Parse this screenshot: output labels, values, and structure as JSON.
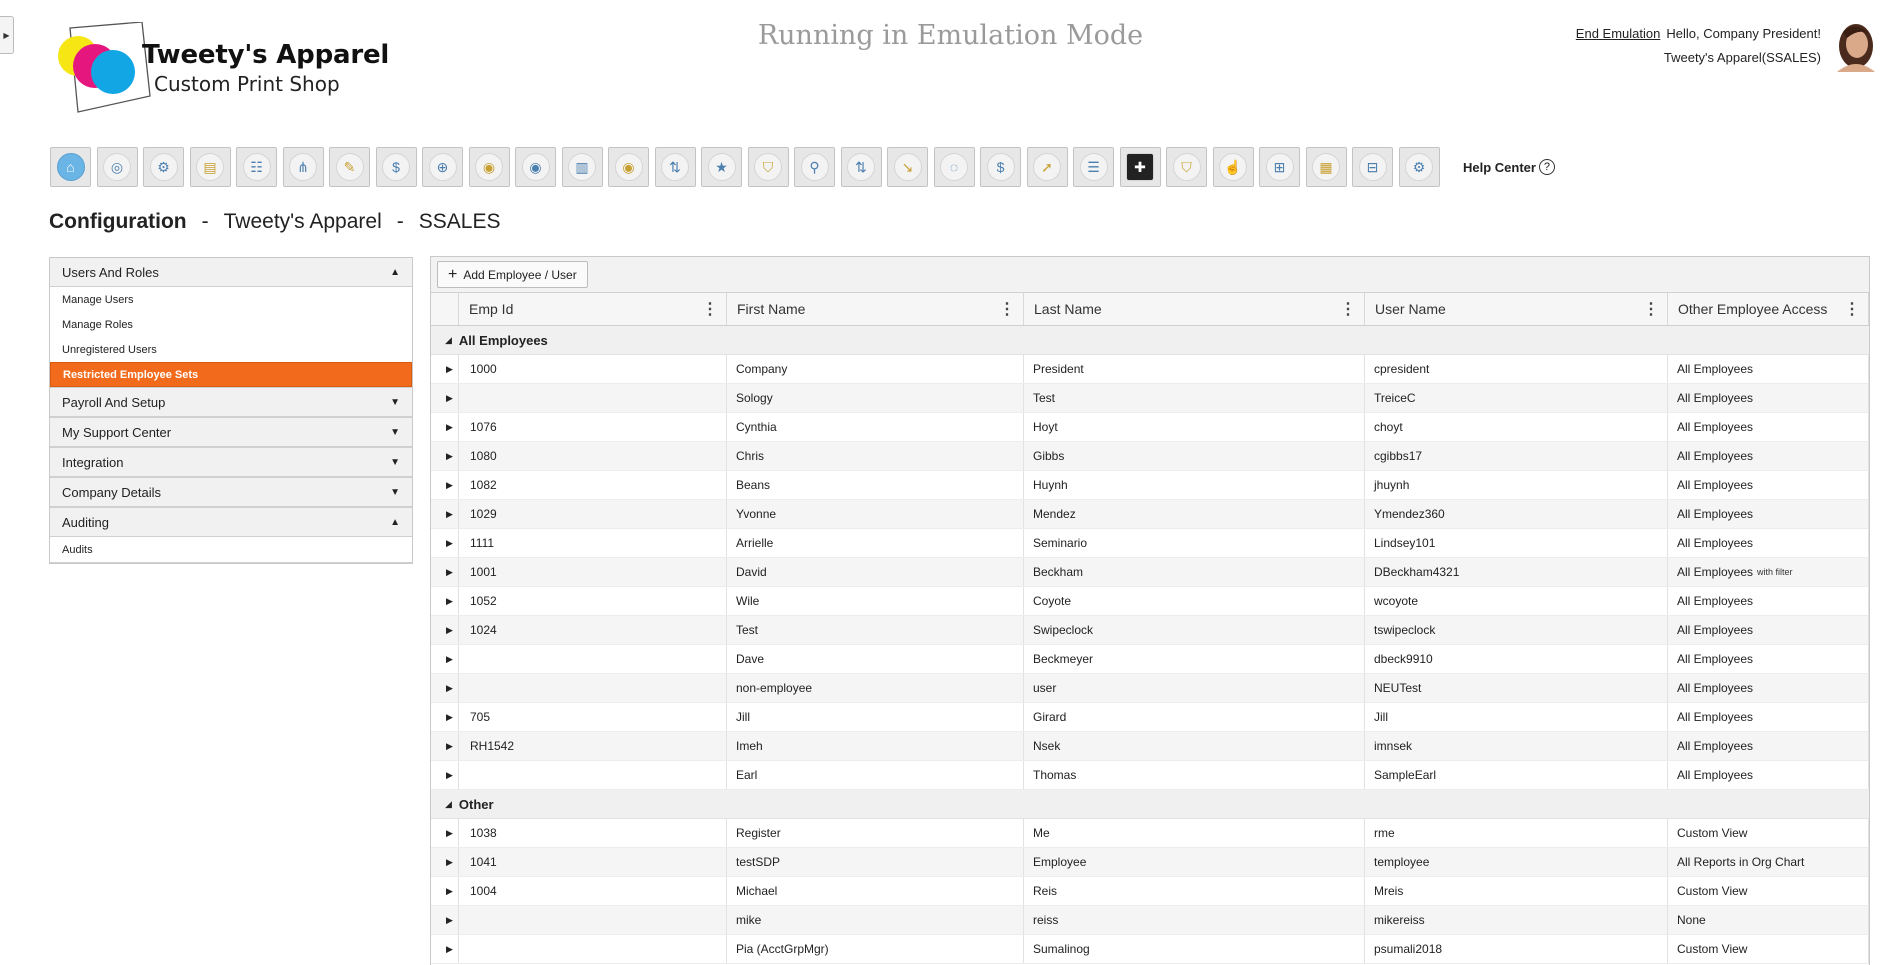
{
  "app": {
    "logo_title": "Tweety's Apparel",
    "logo_subtitle": "Custom Print Shop",
    "emulation_banner": "Running in Emulation Mode",
    "end_emulation": "End Emulation",
    "greeting": "Hello, Company President!",
    "company_context": "Tweety's Apparel(SSALES)"
  },
  "toolbar": {
    "icons": [
      "home-icon",
      "org-icon",
      "people-settings-icon",
      "job-icon",
      "group-icon",
      "hierarchy-icon",
      "form-edit-icon",
      "payroll-bag-icon",
      "search-add-icon",
      "target-icon",
      "target-icon",
      "chart-people-icon",
      "target-icon",
      "swap-icon",
      "person-star-icon",
      "shield-person-icon",
      "people-pin-icon",
      "swap-icon",
      "chart-down-icon",
      "fingerprint-icon",
      "money-bag-icon",
      "person-arrow-icon",
      "stack-people-icon",
      "clipboard-add-icon",
      "shield-person-icon",
      "hand-touch-icon",
      "gift-icon",
      "document-icon",
      "network-icon",
      "settings-search-icon"
    ],
    "help_center": "Help Center"
  },
  "heading": {
    "section": "Configuration",
    "company": "Tweety's Apparel",
    "code": "SSALES"
  },
  "sidebar": {
    "groups": [
      {
        "label": "Users And Roles",
        "expanded": true,
        "items": [
          {
            "label": "Manage Users"
          },
          {
            "label": "Manage Roles"
          },
          {
            "label": "Unregistered Users"
          },
          {
            "label": "Restricted Employee Sets",
            "active": true
          }
        ]
      },
      {
        "label": "Payroll And Setup",
        "expanded": false,
        "items": []
      },
      {
        "label": "My Support Center",
        "expanded": false,
        "items": []
      },
      {
        "label": "Integration",
        "expanded": false,
        "items": []
      },
      {
        "label": "Company Details",
        "expanded": false,
        "items": []
      },
      {
        "label": "Auditing",
        "expanded": true,
        "items": [
          {
            "label": "Audits"
          }
        ]
      }
    ]
  },
  "grid": {
    "add_button": "Add Employee / User",
    "columns": [
      "Emp Id",
      "First Name",
      "Last Name",
      "User Name",
      "Other Employee Access"
    ],
    "groups": [
      {
        "label": "All Employees",
        "rows": [
          {
            "emp_id": "1000",
            "first": "Company",
            "last": "President",
            "user": "cpresident",
            "access": "All Employees"
          },
          {
            "emp_id": "",
            "first": "Sology",
            "last": "Test",
            "user": "TreiceC",
            "access": "All Employees"
          },
          {
            "emp_id": "1076",
            "first": "Cynthia",
            "last": "Hoyt",
            "user": "choyt",
            "access": "All Employees"
          },
          {
            "emp_id": "1080",
            "first": "Chris",
            "last": "Gibbs",
            "user": "cgibbs17",
            "access": "All Employees"
          },
          {
            "emp_id": "1082",
            "first": "Beans",
            "last": "Huynh",
            "user": "jhuynh",
            "access": "All Employees"
          },
          {
            "emp_id": "1029",
            "first": "Yvonne",
            "last": "Mendez",
            "user": "Ymendez360",
            "access": "All Employees"
          },
          {
            "emp_id": "1111",
            "first": "Arrielle",
            "last": "Seminario",
            "user": "Lindsey101",
            "access": "All Employees"
          },
          {
            "emp_id": "1001",
            "first": "David",
            "last": "Beckham",
            "user": "DBeckham4321",
            "access": "All Employees",
            "access_note": "with filter"
          },
          {
            "emp_id": "1052",
            "first": "Wile",
            "last": "Coyote",
            "user": "wcoyote",
            "access": "All Employees"
          },
          {
            "emp_id": "1024",
            "first": "Test",
            "last": "Swipeclock",
            "user": "tswipeclock",
            "access": "All Employees"
          },
          {
            "emp_id": "",
            "first": "Dave",
            "last": "Beckmeyer",
            "user": "dbeck9910",
            "access": "All Employees"
          },
          {
            "emp_id": "",
            "first": "non-employee",
            "last": "user",
            "user": "NEUTest",
            "access": "All Employees"
          },
          {
            "emp_id": "705",
            "first": "Jill",
            "last": "Girard",
            "user": "Jill",
            "access": "All Employees"
          },
          {
            "emp_id": "RH1542",
            "first": "Imeh",
            "last": "Nsek",
            "user": "imnsek",
            "access": "All Employees"
          },
          {
            "emp_id": "",
            "first": "Earl",
            "last": "Thomas",
            "user": "SampleEarl",
            "access": "All Employees"
          }
        ]
      },
      {
        "label": "Other",
        "rows": [
          {
            "emp_id": "1038",
            "first": "Register",
            "last": "Me",
            "user": "rme",
            "access": "Custom View"
          },
          {
            "emp_id": "1041",
            "first": "testSDP",
            "last": "Employee",
            "user": "temployee",
            "access": "All Reports in Org Chart"
          },
          {
            "emp_id": "1004",
            "first": "Michael",
            "last": "Reis",
            "user": "Mreis",
            "access": "Custom View"
          },
          {
            "emp_id": "",
            "first": "mike",
            "last": "reiss",
            "user": "mikereiss",
            "access": "None"
          },
          {
            "emp_id": "",
            "first": "Pia (AcctGrpMgr)",
            "last": "Sumalinog",
            "user": "psumali2018",
            "access": "Custom View"
          }
        ]
      }
    ]
  },
  "colors": {
    "accent": "#f26b1d",
    "logo_yellow": "#f5e614",
    "logo_magenta": "#e5177e",
    "logo_cyan": "#12a6e4"
  }
}
